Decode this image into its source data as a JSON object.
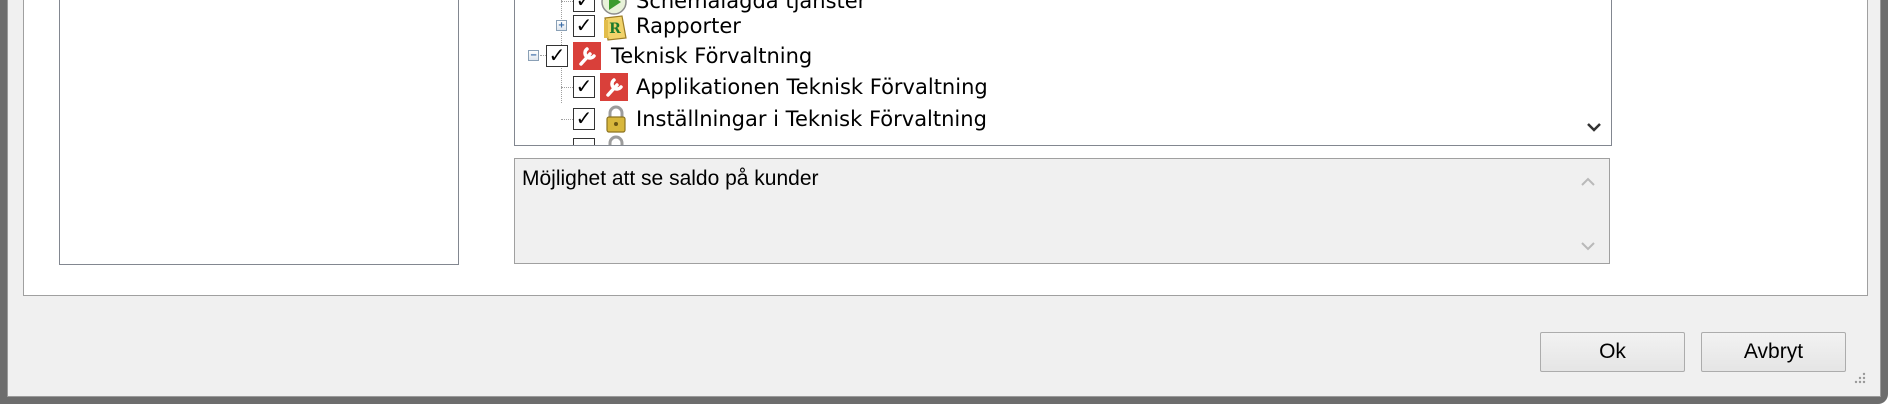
{
  "tree": {
    "rows": [
      {
        "label": "Schemalagda tjänster",
        "checked": true,
        "icon": "scheduled-services-icon"
      },
      {
        "label": "Rapporter",
        "checked": true,
        "icon": "reports-icon",
        "expander": "+"
      },
      {
        "label": "Teknisk Förvaltning",
        "checked": true,
        "icon": "wrench-icon",
        "expander": "−"
      },
      {
        "label": "Applikationen Teknisk Förvaltning",
        "checked": true,
        "icon": "wrench-icon"
      },
      {
        "label": "Inställningar i Teknisk Förvaltning",
        "checked": true,
        "icon": "lock-icon"
      }
    ]
  },
  "description": {
    "text": "Möjlighet att se saldo på kunder"
  },
  "buttons": {
    "ok": "Ok",
    "cancel": "Avbryt"
  },
  "colors": {
    "window_frame": "#6d6d6d",
    "dialog_background": "#f0f0f0",
    "wrench_icon_red": "#d9403a",
    "reports_icon_yellow": "#f1d36a",
    "lock_icon_gold": "#d8b73c"
  }
}
